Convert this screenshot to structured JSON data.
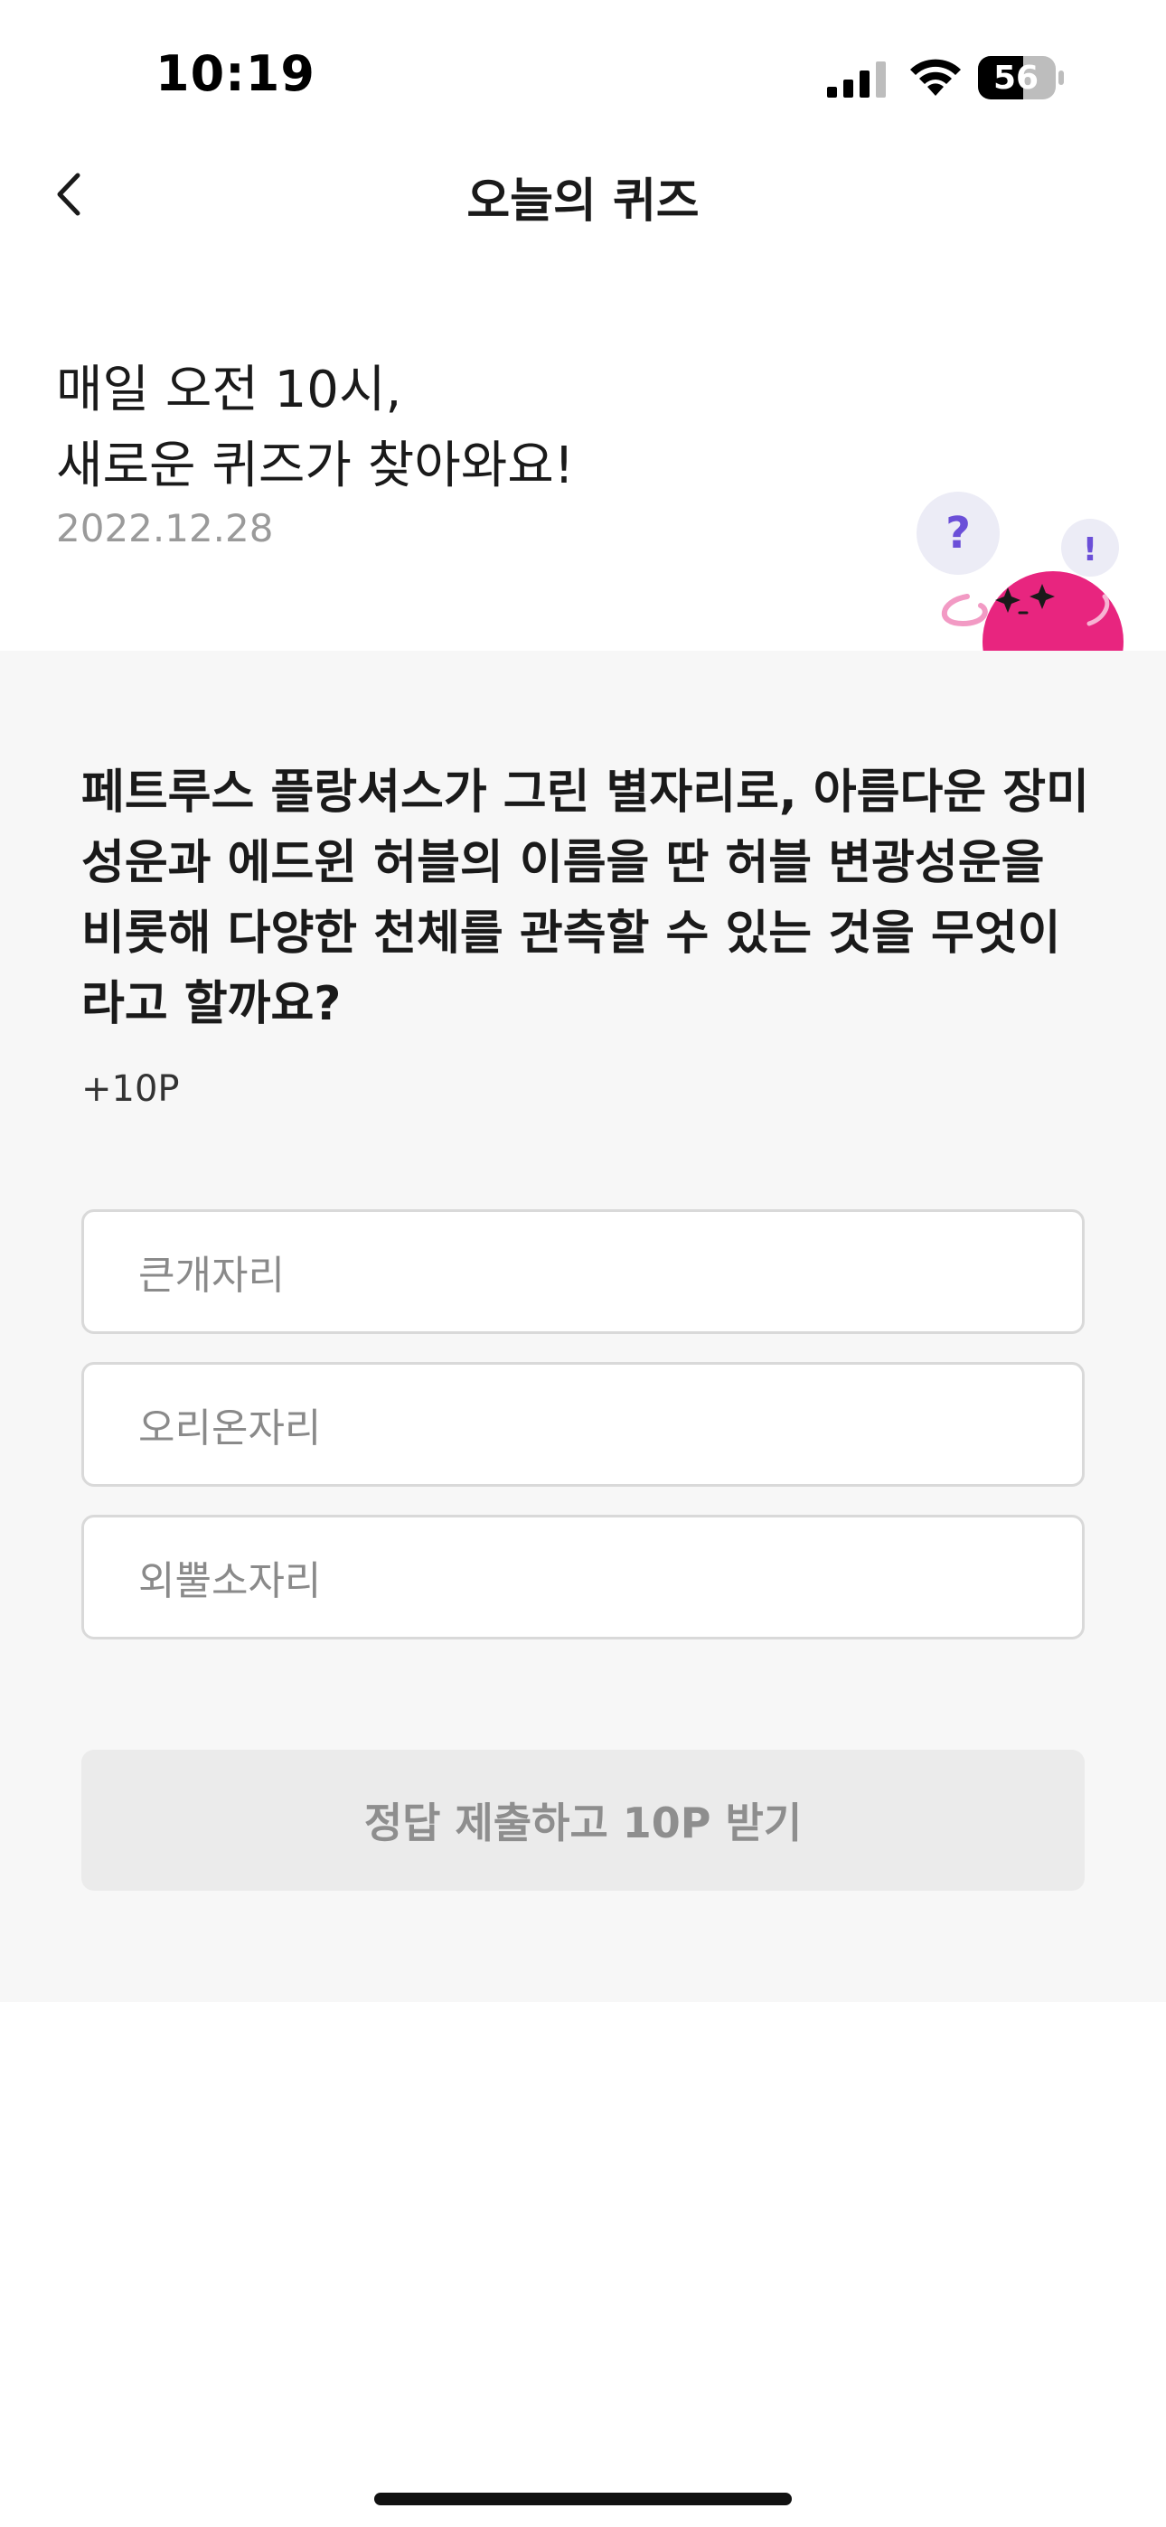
{
  "status_bar": {
    "time": "10:19",
    "battery": "56",
    "icons": [
      "signal-icon",
      "wifi-icon",
      "battery-icon"
    ]
  },
  "nav": {
    "title": "오늘의 퀴즈",
    "back_icon": "chevron-left-icon"
  },
  "header": {
    "headline_lines": [
      "매일 오전 10시,",
      "새로운 퀴즈가 찾아와요!"
    ],
    "date": "2022.12.28",
    "mascot": {
      "question_mark": "?",
      "exclamation_mark": "!",
      "color": "#e8257f"
    }
  },
  "quiz": {
    "question_lines": [
      "페트루스 플랑셔스가 그린 별자리로, 아름다운 장미",
      "성운과 에드윈 허블의 이름을 딴 허블 변광성운을",
      "비롯해 다양한 천체를 관측할 수 있는 것을 무엇이",
      "라고 할까요?"
    ],
    "points": "+10P",
    "options": [
      "큰개자리",
      "오리온자리",
      "외뿔소자리"
    ],
    "submit_label": "정답 제출하고 10P 받기"
  },
  "colors": {
    "panel_background": "#f7f7f7",
    "submit_disabled_background": "#ebebeb",
    "mascot_pink": "#e8257f",
    "bubble_purple": "#6b4fd8"
  }
}
